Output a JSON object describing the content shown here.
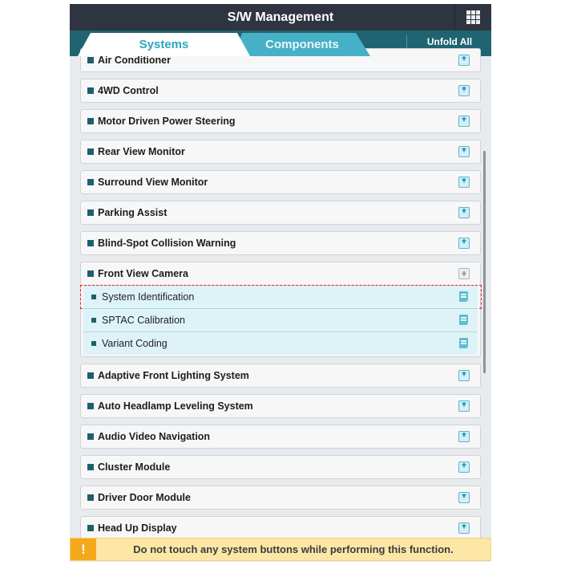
{
  "header": {
    "title": "S/W Management",
    "menu_icon": "grid-icon"
  },
  "tabs": [
    {
      "label": "Systems",
      "active": true
    },
    {
      "label": "Components",
      "active": false
    }
  ],
  "toolbar": {
    "unfold_all_label": "Unfold All"
  },
  "list": {
    "items_before": [
      {
        "label": "Air Conditioner",
        "icon": "download-icon"
      },
      {
        "label": "4WD Control",
        "icon": "download-icon"
      },
      {
        "label": "Motor Driven Power Steering",
        "icon": "download-icon"
      },
      {
        "label": "Rear View Monitor",
        "icon": "download-icon"
      },
      {
        "label": "Surround View Monitor",
        "icon": "download-icon"
      },
      {
        "label": "Parking Assist",
        "icon": "download-icon"
      },
      {
        "label": "Blind-Spot Collision Warning",
        "icon": "download-icon"
      }
    ],
    "expanded_group": {
      "label": "Front View Camera",
      "icon": "collapse-up-icon",
      "sub_items": [
        {
          "label": "System Identification",
          "icon": "document-icon",
          "selected": true
        },
        {
          "label": "SPTAC Calibration",
          "icon": "document-icon",
          "selected": false
        },
        {
          "label": "Variant Coding",
          "icon": "document-icon",
          "selected": false
        }
      ]
    },
    "items_after": [
      {
        "label": "Adaptive Front Lighting System",
        "icon": "download-icon"
      },
      {
        "label": "Auto Headlamp Leveling System",
        "icon": "download-icon"
      },
      {
        "label": "Audio Video Navigation",
        "icon": "download-icon"
      },
      {
        "label": "Cluster Module",
        "icon": "download-icon"
      },
      {
        "label": "Driver Door Module",
        "icon": "download-icon"
      },
      {
        "label": "Head Up Display",
        "icon": "download-icon"
      }
    ]
  },
  "warning": {
    "icon": "!",
    "text": "Do not touch any system buttons while performing this function."
  },
  "colors": {
    "header_bg": "#2e3540",
    "tabbar_bg": "#1f6470",
    "active_tab_text": "#2aa6c0",
    "inactive_tab_bg": "#46b0c6",
    "sub_item_bg": "#ddf3f8",
    "selection_outline": "#e02020",
    "warning_bg": "#fde7a6",
    "warning_icon_bg": "#f6a81b"
  }
}
